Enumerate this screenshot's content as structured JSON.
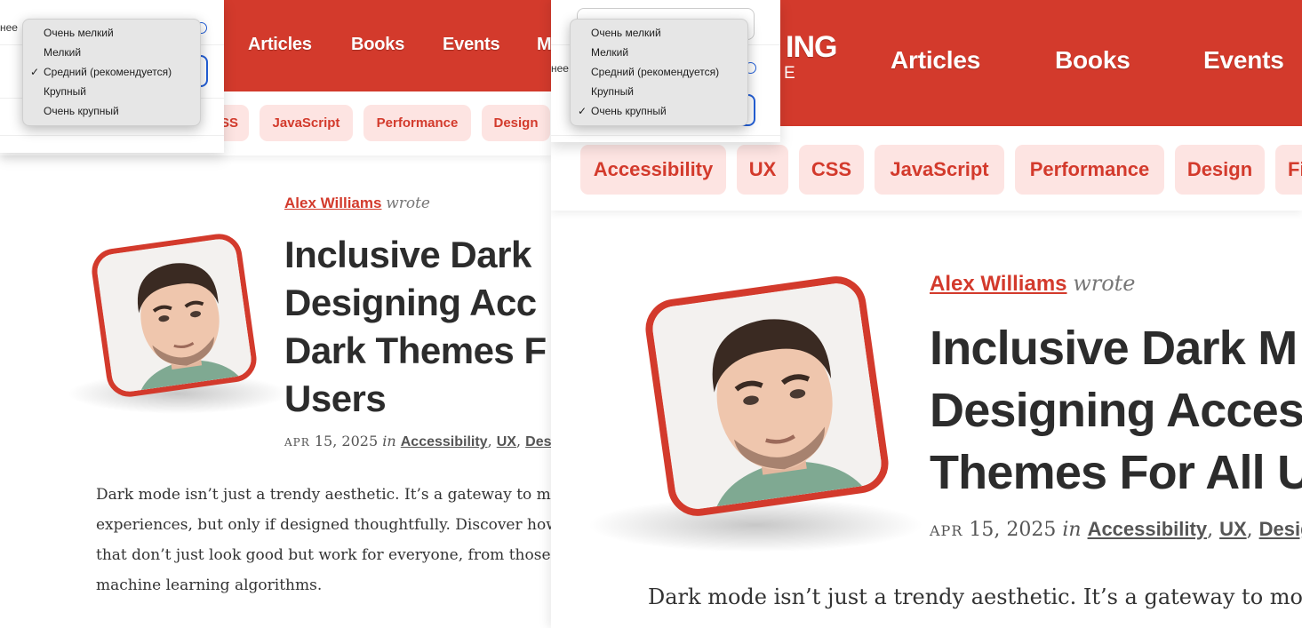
{
  "nav": {
    "articles": "Articles",
    "books": "Books",
    "events": "Events",
    "more_partial": "M"
  },
  "logo_partial": {
    "line1": "ING",
    "line2": "E"
  },
  "tags": [
    "Accessibility",
    "UX",
    "CSS",
    "JavaScript",
    "Performance",
    "Design",
    "Fi"
  ],
  "tags_left_visible": {
    "css_partial": "SS",
    "javascript": "JavaScript",
    "performance": "Performance",
    "design": "Design"
  },
  "article": {
    "author": "Alex Williams",
    "wrote": "wrote",
    "title_left_lines": [
      "Inclusive Dark",
      "Designing Acc",
      "Dark Themes F",
      "Users"
    ],
    "title_right_lines": [
      "Inclusive Dark M",
      "Designing Acces",
      "Themes For All U"
    ],
    "date_month": "APR",
    "date_rest": "15, 2025",
    "in": "in",
    "categories": [
      "Accessibility",
      "UX",
      "Desi"
    ],
    "categories_right_last": "Desig",
    "excerpt_left_lines": [
      "Dark mode isn’t just a trendy aesthetic. It’s a gateway to more",
      "experiences, but only if designed thoughtfully. Discover how",
      "that don’t just look good but work for everyone, from those w",
      "machine learning algorithms."
    ],
    "excerpt_right_line": "Dark mode isn’t just a trendy aesthetic. It’s a gateway to more in"
  },
  "settings_partial_label": "нее",
  "font_size_dropdown": {
    "options": [
      "Очень мелкий",
      "Мелкий",
      "Средний (рекомендуется)",
      "Крупный",
      "Очень крупный"
    ],
    "left_selected": "Средний (рекомендуется)",
    "right_selected": "Очень крупный",
    "checkmark": "✓"
  },
  "colors": {
    "brand_red": "#d33a2c",
    "tag_bg": "#fde4e2",
    "focus_blue": "#2460d8"
  }
}
